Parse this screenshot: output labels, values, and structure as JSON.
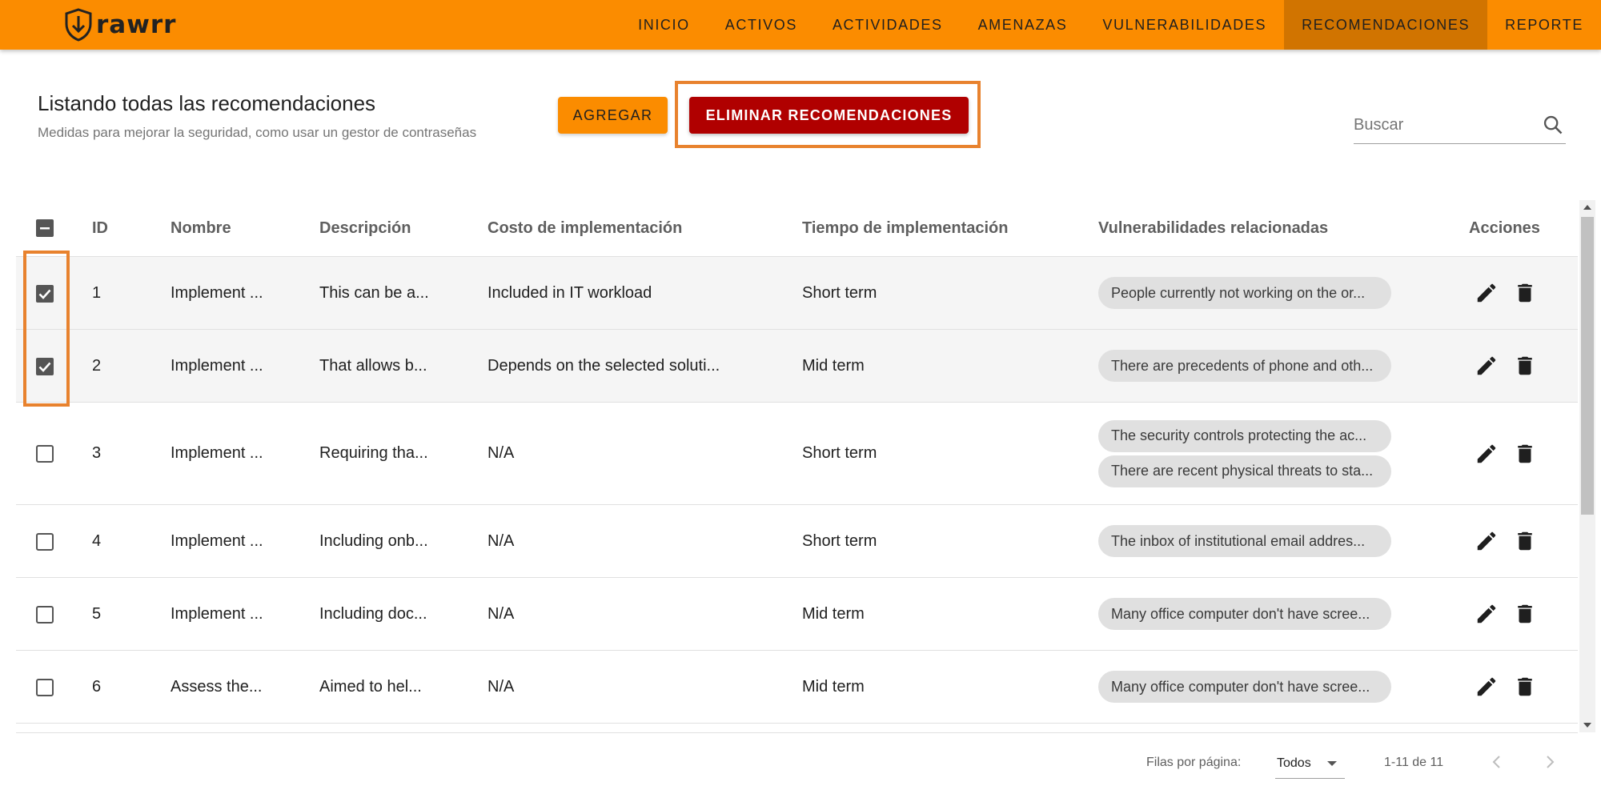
{
  "app": {
    "logo_text": "rawrr",
    "nav": [
      {
        "label": "INICIO"
      },
      {
        "label": "ACTIVOS"
      },
      {
        "label": "ACTIVIDADES"
      },
      {
        "label": "AMENAZAS"
      },
      {
        "label": "VULNERABILIDADES"
      },
      {
        "label": "RECOMENDACIONES"
      },
      {
        "label": "REPORTE"
      }
    ],
    "active_nav": "RECOMENDACIONES",
    "accent_color": "#fb8c00",
    "danger_color": "#b00000"
  },
  "header": {
    "title": "Listando todas las recomendaciones",
    "subtitle": "Medidas para mejorar la seguridad, como usar un gestor de contraseñas",
    "add_label": "AGREGAR",
    "delete_label": "ELIMINAR RECOMENDACIONES",
    "search_placeholder": "Buscar"
  },
  "table": {
    "columns": {
      "id": "ID",
      "name": "Nombre",
      "description": "Descripción",
      "cost": "Costo de implementación",
      "time": "Tiempo de implementación",
      "vulns": "Vulnerabilidades relacionadas",
      "actions": "Acciones"
    },
    "select_all_state": "indeterminate",
    "rows": [
      {
        "id": "1",
        "name": "Implement ...",
        "description": "This can be a...",
        "cost": "Included in IT workload",
        "time": "Short term",
        "selected": true,
        "vulns": [
          "People currently not working on the or..."
        ]
      },
      {
        "id": "2",
        "name": "Implement ...",
        "description": "That allows b...",
        "cost": "Depends on the selected soluti...",
        "time": "Mid term",
        "selected": true,
        "vulns": [
          "There are precedents of phone and oth..."
        ]
      },
      {
        "id": "3",
        "name": "Implement ...",
        "description": "Requiring tha...",
        "cost": "N/A",
        "time": "Short term",
        "selected": false,
        "vulns": [
          "The security controls protecting the ac...",
          "There are recent physical threats to sta..."
        ]
      },
      {
        "id": "4",
        "name": "Implement ...",
        "description": "Including onb...",
        "cost": "N/A",
        "time": "Short term",
        "selected": false,
        "vulns": [
          "The inbox of institutional email addres..."
        ]
      },
      {
        "id": "5",
        "name": "Implement ...",
        "description": "Including doc...",
        "cost": "N/A",
        "time": "Mid term",
        "selected": false,
        "vulns": [
          "Many office computer don't have scree..."
        ]
      },
      {
        "id": "6",
        "name": "Assess the...",
        "description": "Aimed to hel...",
        "cost": "N/A",
        "time": "Mid term",
        "selected": false,
        "vulns": [
          "Many office computer don't have scree..."
        ]
      }
    ]
  },
  "footer": {
    "rows_per_page_label": "Filas por página:",
    "rows_per_page_value": "Todos",
    "range": "1-11 de 11"
  }
}
